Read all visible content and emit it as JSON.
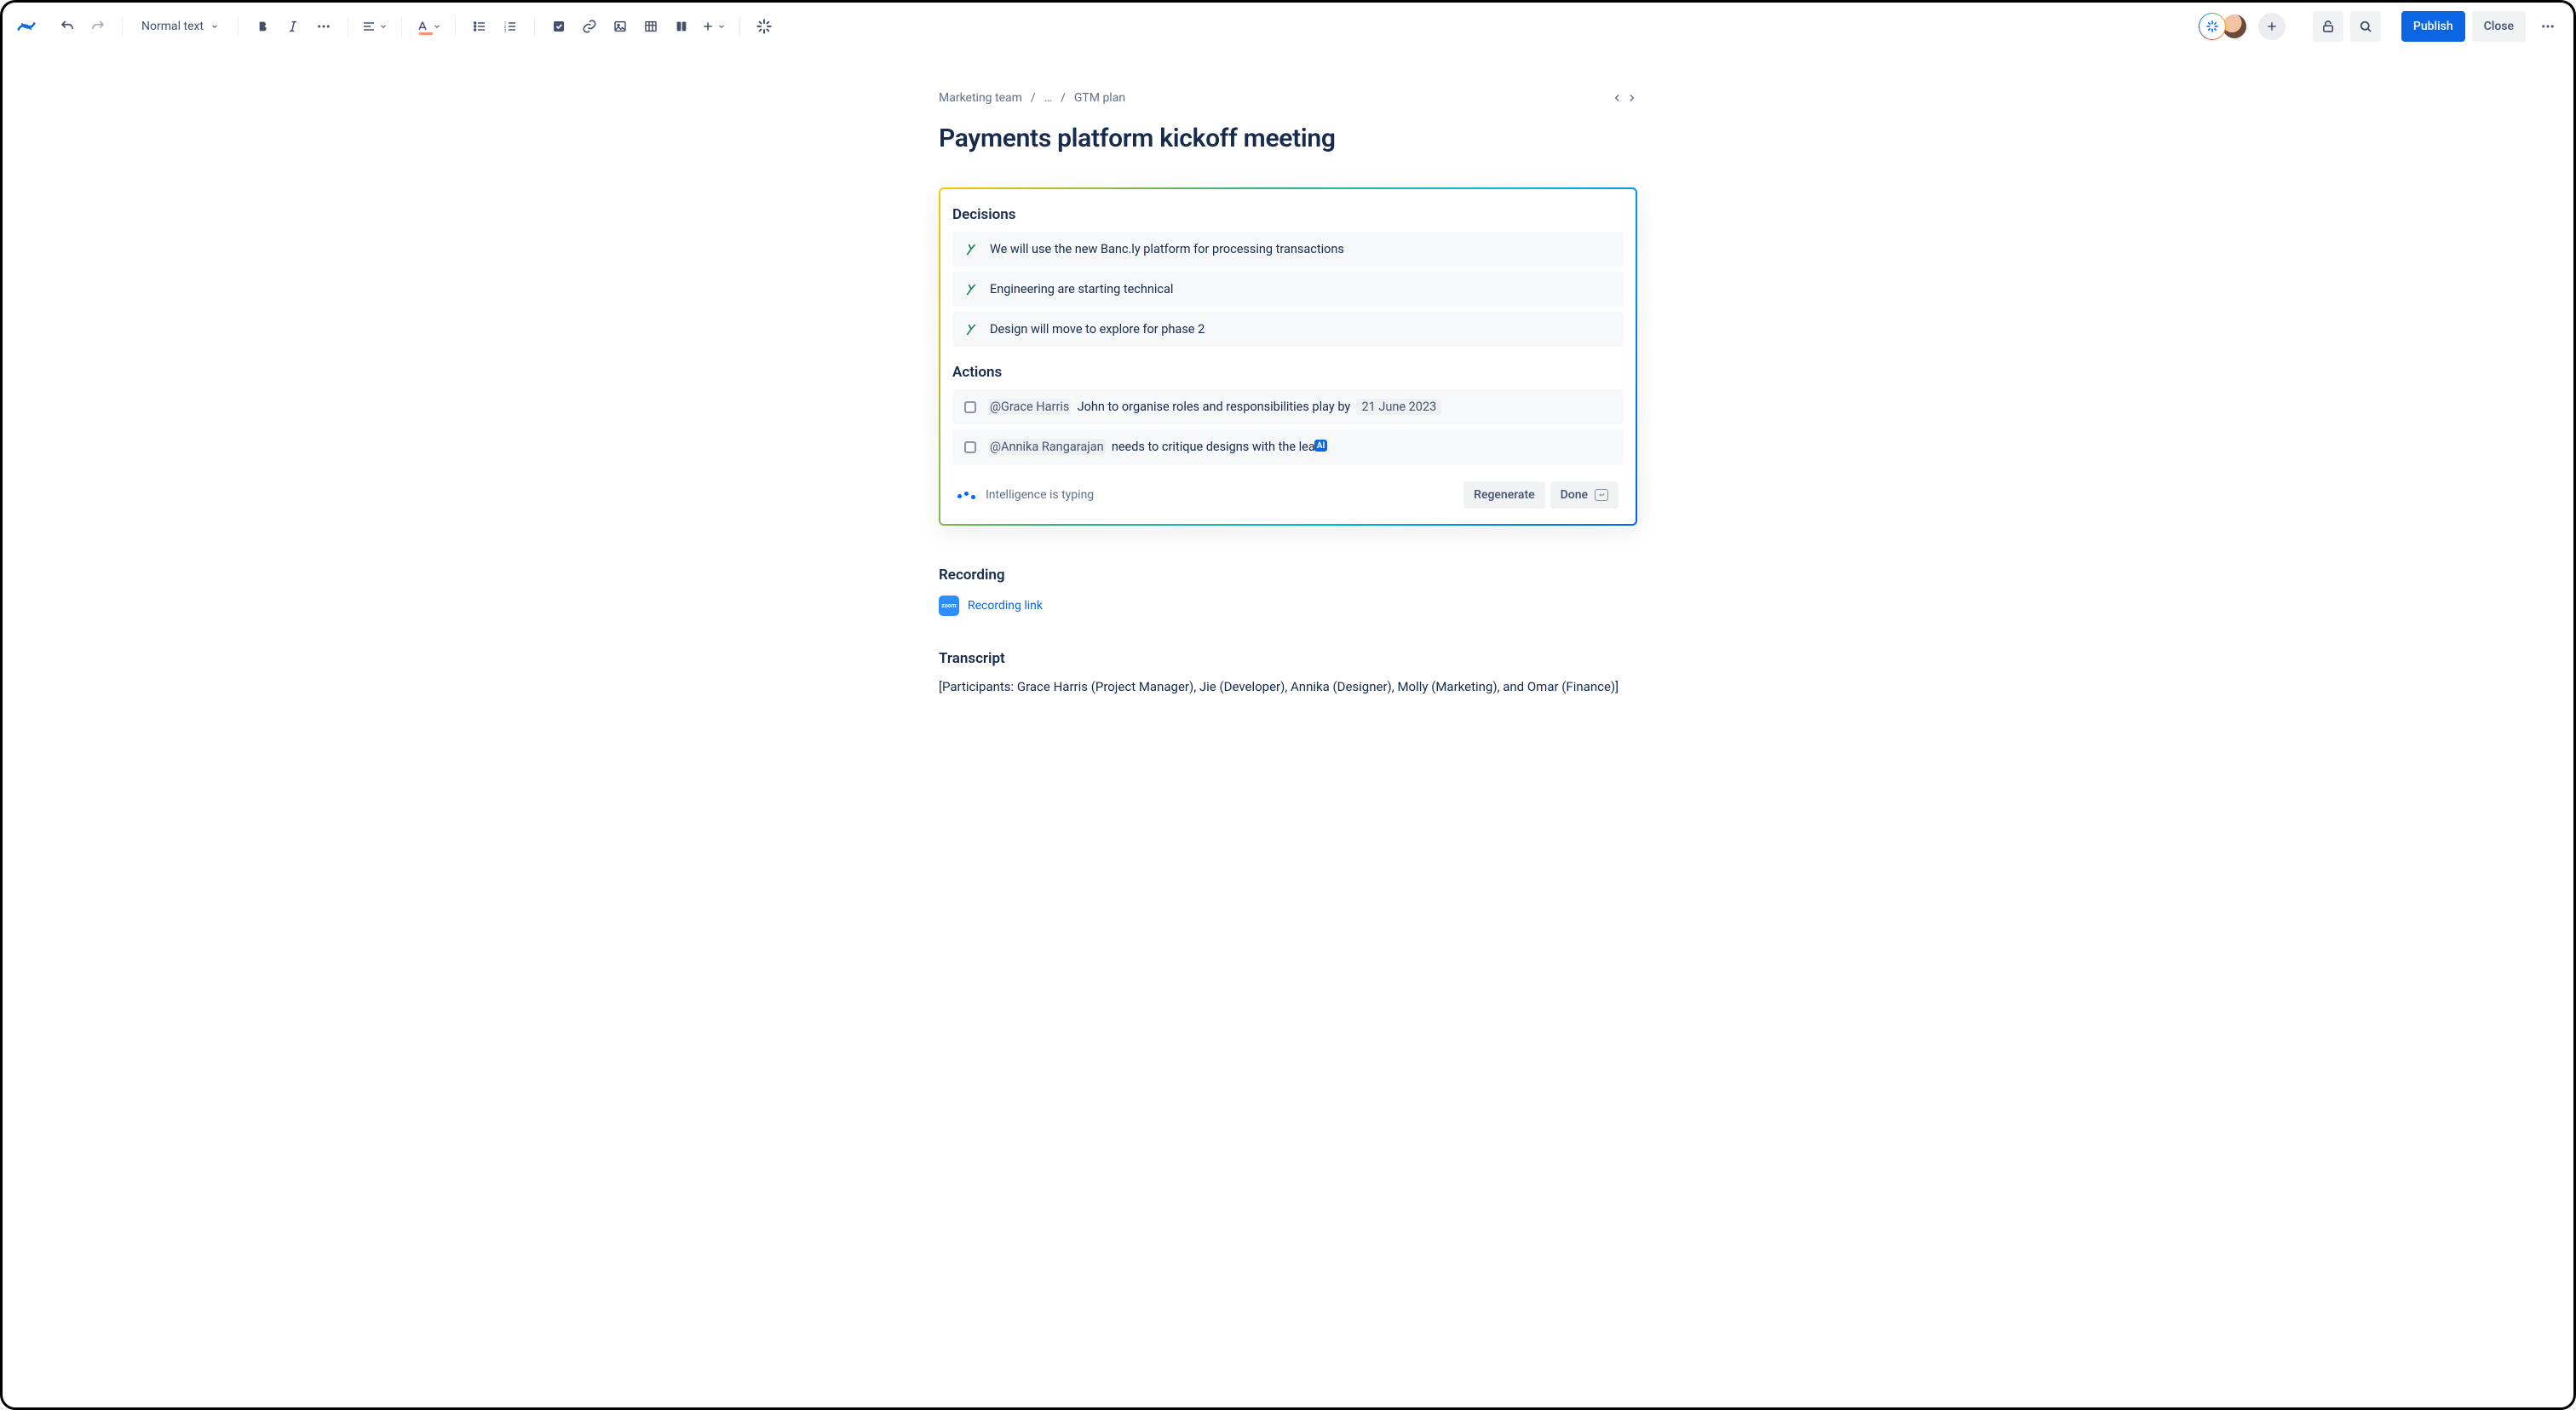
{
  "toolbar": {
    "text_style": "Normal text",
    "publish": "Publish",
    "close": "Close"
  },
  "breadcrumbs": {
    "root": "Marketing team",
    "mid": "…",
    "leaf": "GTM plan"
  },
  "page_title": "Payments platform kickoff meeting",
  "ai_panel": {
    "decisions_heading": "Decisions",
    "decisions": [
      "We will use the new Banc.ly platform for processing transactions",
      "Engineering are starting technical",
      "Design will move to explore for phase 2"
    ],
    "actions_heading": "Actions",
    "actions": [
      {
        "mention": "Grace Harris",
        "body": "John to organise roles and responsibilities play by",
        "date": "21 June 2023"
      },
      {
        "mention": "Annika Rangarajan",
        "body": "needs to critique designs with the lea",
        "ai_badge": "AI"
      }
    ],
    "typing": "Intelligence is typing",
    "regenerate": "Regenerate",
    "done": "Done"
  },
  "recording": {
    "heading": "Recording",
    "link": "Recording link",
    "badge": "zoom"
  },
  "transcript": {
    "heading": "Transcript",
    "body": "[Participants: Grace Harris (Project Manager), Jie (Developer),  Annika (Designer), Molly (Marketing), and  Omar (Finance)]"
  }
}
